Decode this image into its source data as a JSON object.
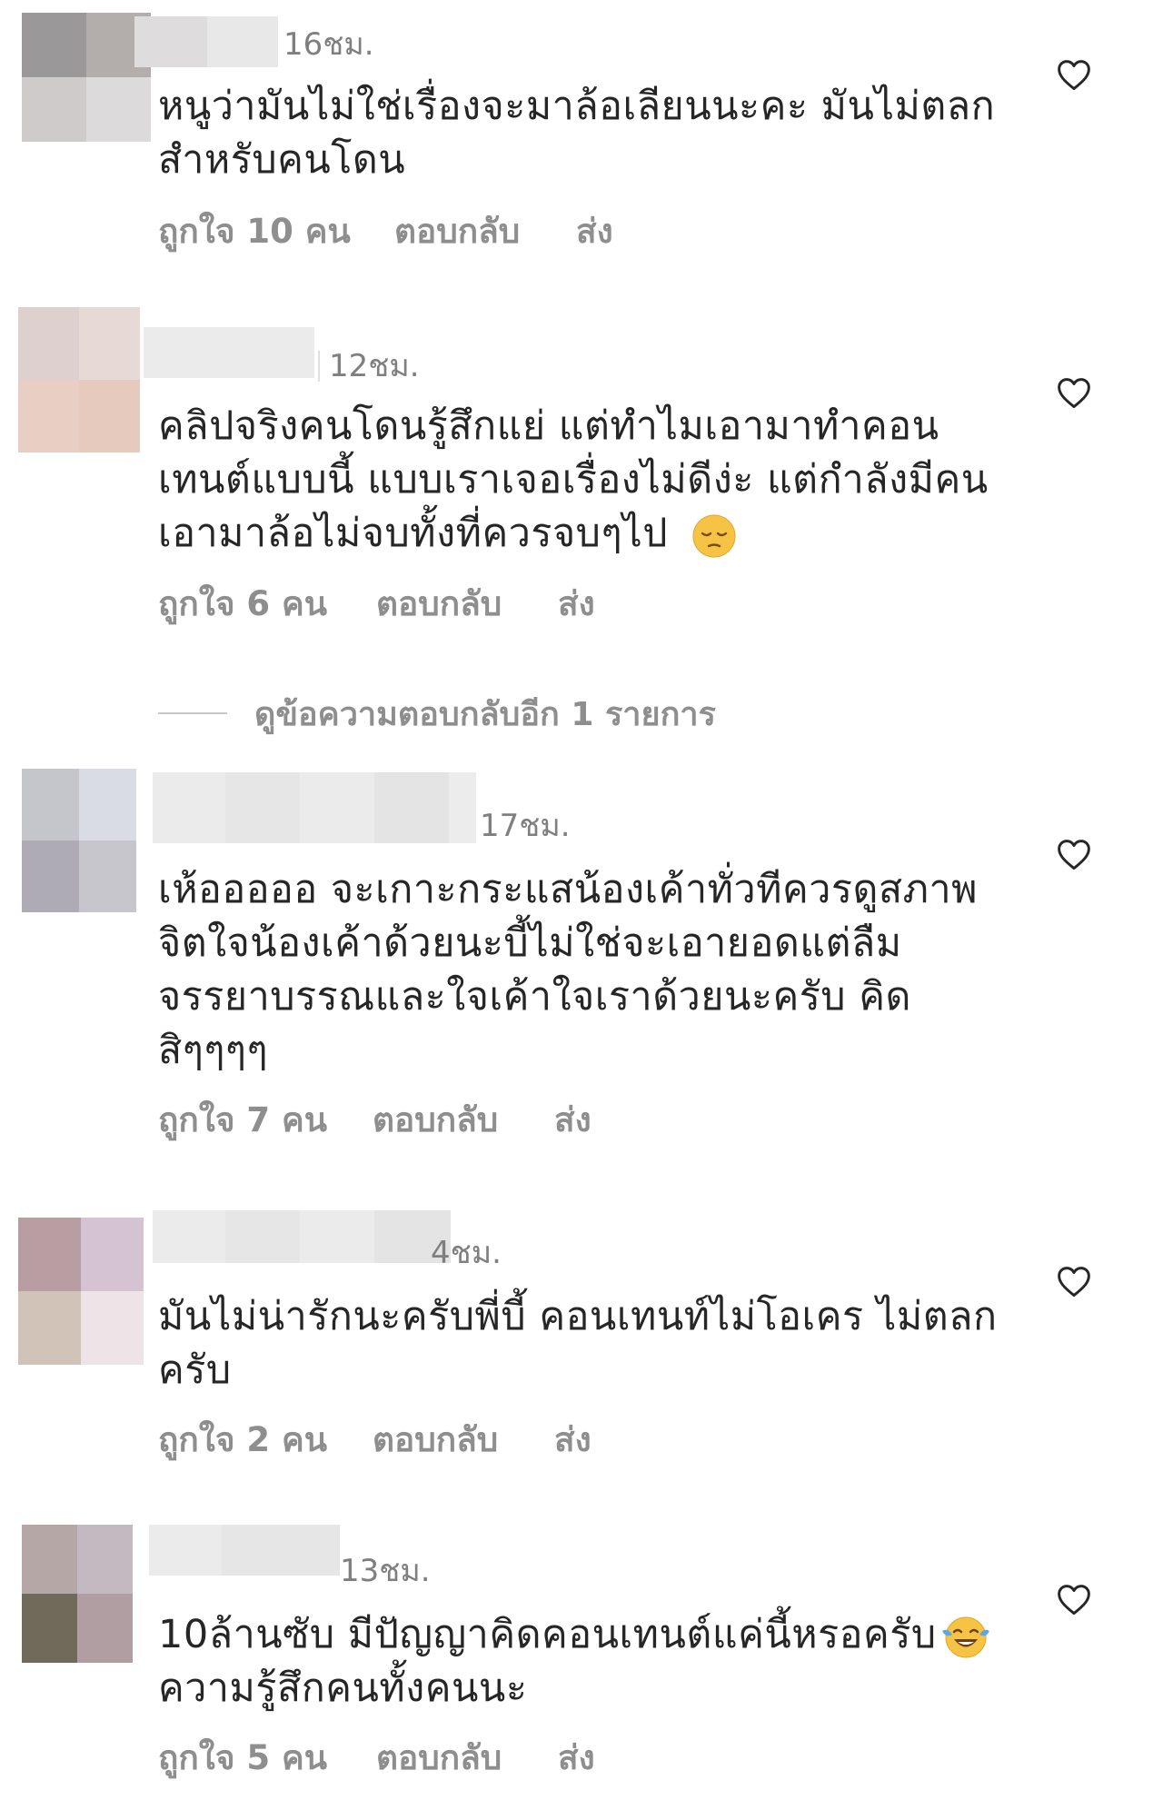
{
  "comments": [
    {
      "time": "16ชม.",
      "lines": [
        "หนูว่ามันไม่ใช่เรื่องจะมาล้อเลียนนะคะ มันไม่ตลก",
        "สำหรับคนโดน"
      ],
      "likes": "ถูกใจ 10 คน",
      "reply": "ตอบกลับ",
      "send": "ส่ง"
    },
    {
      "time": "12ชม.",
      "lines": [
        "คลิปจริงคนโดนรู้สึกแย่  แต่ทำไมเอามาทำคอน",
        "เทนต์แบบนี้ แบบเราเจอเรื่องไม่ดีง่ะ  แต่กำลังมีคน",
        "เอามาล้อไม่จบทั้งที่ควรจบๆไป"
      ],
      "emoji": "pensive-face",
      "likes": "ถูกใจ 6 คน",
      "reply": "ตอบกลับ",
      "send": "ส่ง"
    },
    {
      "time": "17ชม.",
      "lines": [
        "เห้อออออ จะเกาะกระแสน้องเค้าทั่วทีควรดูสภาพ",
        "จิตใจน้องเค้าด้วยนะบี้ไม่ใช่จะเอายอดแต่ลืม",
        "จรรยาบรรณและใจเค้าใจเราด้วยนะครับ คิด",
        "สิๆๆๆๆ"
      ],
      "likes": "ถูกใจ 7 คน",
      "reply": "ตอบกลับ",
      "send": "ส่ง"
    },
    {
      "time": "4ชม.",
      "lines": [
        "มันไม่น่ารักนะครับพี่บี้ คอนเทนท์ไม่โอเคร ไม่ตลก",
        "ครับ"
      ],
      "likes": "ถูกใจ 2 คน",
      "reply": "ตอบกลับ",
      "send": "ส่ง"
    },
    {
      "time": "13ชม.",
      "lines": [
        "10ล้านซับ มีปัญญาคิดคอนเทนต์แค่นี้หรอครับ",
        "ความรู้สึกคนทั้งคนนะ"
      ],
      "emoji": "face-with-tears-of-joy",
      "likes": "ถูกใจ 5 คน",
      "reply": "ตอบกลับ",
      "send": "ส่ง"
    }
  ],
  "view_replies": "ดูข้อความตอบกลับอีก 1 รายการ",
  "colors": {
    "text": "#262626",
    "muted": "#8e8e8e",
    "time": "#7f7f7f"
  },
  "icons": {
    "like": "heart-outline-icon"
  }
}
